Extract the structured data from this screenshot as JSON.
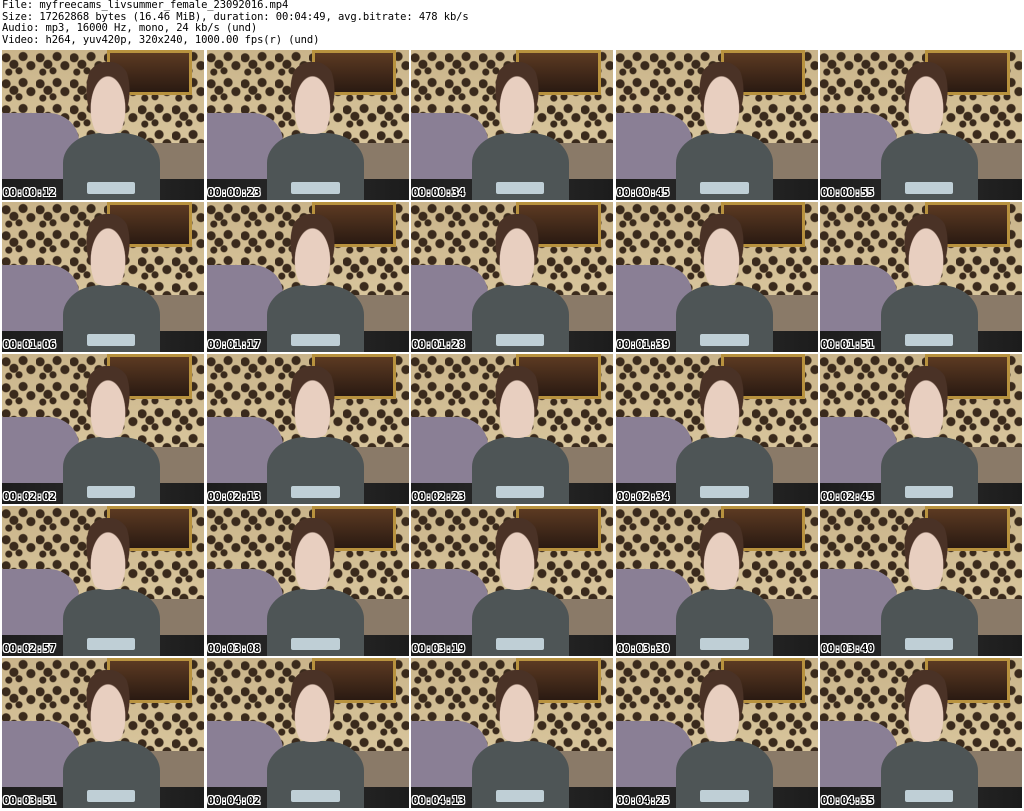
{
  "header": {
    "file_line": "File: myfreecams_livsummer_female_23092016.mp4",
    "size_line": "Size: 17262868 bytes (16.46 MiB), duration: 00:04:49, avg.bitrate: 478 kb/s",
    "audio_line": "Audio: mp3, 16000 Hz, mono, 24 kb/s (und)",
    "video_line": "Video: h264, yuv420p, 320x240, 1000.00 fps(r) (und)"
  },
  "thumbnails": [
    {
      "timestamp": "00:00:12"
    },
    {
      "timestamp": "00:00:23"
    },
    {
      "timestamp": "00:00:34"
    },
    {
      "timestamp": "00:00:45"
    },
    {
      "timestamp": "00:00:55"
    },
    {
      "timestamp": "00:01:06"
    },
    {
      "timestamp": "00:01:17"
    },
    {
      "timestamp": "00:01:28"
    },
    {
      "timestamp": "00:01:39"
    },
    {
      "timestamp": "00:01:51"
    },
    {
      "timestamp": "00:02:02"
    },
    {
      "timestamp": "00:02:13"
    },
    {
      "timestamp": "00:02:23"
    },
    {
      "timestamp": "00:02:34"
    },
    {
      "timestamp": "00:02:45"
    },
    {
      "timestamp": "00:02:57"
    },
    {
      "timestamp": "00:03:08"
    },
    {
      "timestamp": "00:03:19"
    },
    {
      "timestamp": "00:03:30"
    },
    {
      "timestamp": "00:03:40"
    },
    {
      "timestamp": "00:03:51"
    },
    {
      "timestamp": "00:04:02"
    },
    {
      "timestamp": "00:04:13"
    },
    {
      "timestamp": "00:04:25"
    },
    {
      "timestamp": "00:04:35"
    }
  ]
}
